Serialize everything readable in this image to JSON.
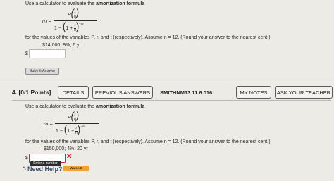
{
  "q3": {
    "instruction_prefix": "Use a calculator to evaluate the",
    "instruction_bold": "amortization formula",
    "formula": {
      "lhs": "m =",
      "numerator": "P",
      "r": "r",
      "n": "n",
      "one": "1 −",
      "one_plus": "1 +",
      "exponent": "−nt"
    },
    "values_text": "for the values of the variables P, r, and t (respectively). Assume n = 12. (Round your answer to the nearest cent.)",
    "given": "$14,000; 9%; 6 yr",
    "dollar": "$",
    "answer_value": "",
    "submit_label": "Submit Answer"
  },
  "q4": {
    "number": "4.",
    "points": "[0/1 Points]",
    "details_label": "DETAILS",
    "previous_answers_label": "PREVIOUS ANSWERS",
    "problem_id": "SMITHNM13 11.6.016.",
    "my_notes_label": "MY NOTES",
    "ask_teacher_label": "ASK YOUR TEACHER",
    "instruction_prefix": "Use a calculator to evaluate the",
    "instruction_bold": "amortization formula",
    "formula": {
      "lhs": "m =",
      "numerator": "P",
      "r": "r",
      "n": "n",
      "one": "1 −",
      "one_plus": "1 +",
      "exponent": "−nt"
    },
    "values_text": "for the values of the variables P, r, and t (respectively). Assume n = 12. (Round your answer to the nearest cent.)",
    "given": "$150,000; 4%; 20 yr",
    "dollar": "$",
    "answer_value": "",
    "error_mark": "✕",
    "tooltip": "Enter a number.",
    "need_help": "Need Help?",
    "watch_label": "Watch It"
  },
  "colors": {
    "background": "#ecebe6",
    "error_red": "#cc2a2a",
    "watch_orange": "#f0a23a"
  }
}
